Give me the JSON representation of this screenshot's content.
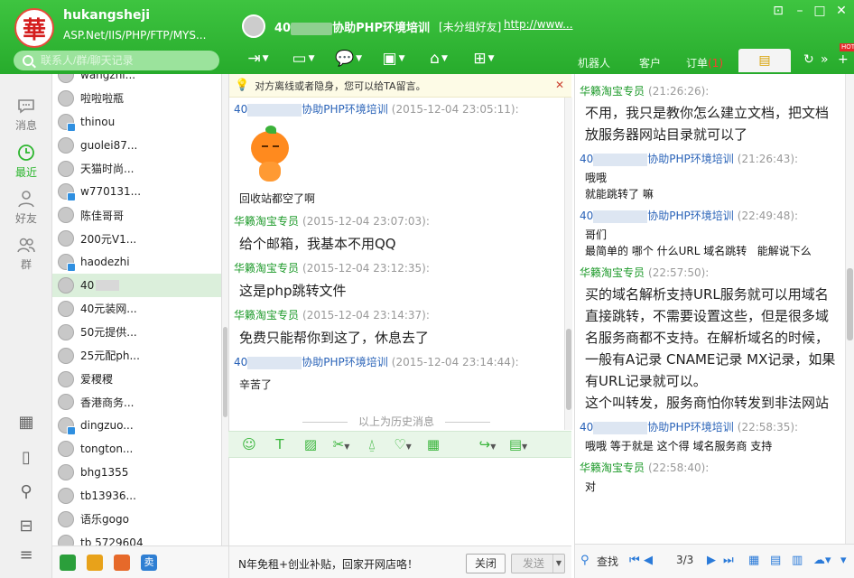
{
  "profile": {
    "avatar_char": "華",
    "name": "hukangsheji",
    "signature": "ASP.Net/IIS/PHP/FTP/MYS..."
  },
  "search": {
    "placeholder": "联系人/群/聊天记录"
  },
  "chat_header": {
    "title_prefix": "40",
    "title_suffix": "协助PHP环境培训",
    "group": "[未分组好友]",
    "url": "http://www..."
  },
  "window_controls": [
    "pin-icon",
    "minimize-icon",
    "maximize-icon",
    "close-icon"
  ],
  "toolbar_icons": [
    "transfer-icon",
    "video-icon",
    "message-icon",
    "screen-icon",
    "remote-icon",
    "schedule-icon"
  ],
  "right_tabs": {
    "robot": "机器人",
    "customer": "客户",
    "order": "订单",
    "order_count": "(1)"
  },
  "left_nav": {
    "messages": "消息",
    "recent": "最近",
    "friends": "好友",
    "groups": "群"
  },
  "contacts": [
    {
      "name": "wangzhi...",
      "badge": false
    },
    {
      "name": "啦啦啦瓶",
      "badge": false
    },
    {
      "name": "thinou",
      "badge": true
    },
    {
      "name": "guolei87...",
      "badge": false
    },
    {
      "name": "天猫时尚...",
      "badge": false
    },
    {
      "name": "w770131...",
      "badge": true
    },
    {
      "name": "陈佳哥哥",
      "badge": false
    },
    {
      "name": "200元V1...",
      "badge": false
    },
    {
      "name": "haodezhi",
      "badge": true
    },
    {
      "name": "40",
      "badge": false,
      "selected": true
    },
    {
      "name": "40元装网...",
      "badge": false
    },
    {
      "name": "50元提供...",
      "badge": false
    },
    {
      "name": "25元配ph...",
      "badge": false
    },
    {
      "name": "爱稷稷",
      "badge": false
    },
    {
      "name": "香港商务...",
      "badge": false
    },
    {
      "name": "dingzuo...",
      "badge": true
    },
    {
      "name": "tongton...",
      "badge": false
    },
    {
      "name": "bhg1355",
      "badge": false
    },
    {
      "name": "tb13936...",
      "badge": false
    },
    {
      "name": "语乐gogo",
      "badge": false
    },
    {
      "name": "tb 5729604",
      "badge": false
    }
  ],
  "notice": "对方离线或者隐身，您可以给TA留言。",
  "chat_messages": [
    {
      "side": "them",
      "sender": "40",
      "sender_suffix": "协助PHP环境培训",
      "time": "(2015-12-04 23:05:11):",
      "text": "回收站都空了啊",
      "sticker": true,
      "size": "small"
    },
    {
      "side": "us",
      "sender": "华籁淘宝专员",
      "sender_suffix": "",
      "time": "(2015-12-04 23:07:03):",
      "text": "给个邮箱，我基本不用QQ",
      "sticker": false,
      "size": "big"
    },
    {
      "side": "us",
      "sender": "华籁淘宝专员",
      "sender_suffix": "",
      "time": "(2015-12-04 23:12:35):",
      "text": "这是php跳转文件",
      "sticker": false,
      "size": "big"
    },
    {
      "side": "us",
      "sender": "华籁淘宝专员",
      "sender_suffix": "",
      "time": "(2015-12-04 23:14:37):",
      "text": "免费只能帮你到这了，休息去了",
      "sticker": false,
      "size": "big"
    },
    {
      "side": "them",
      "sender": "40",
      "sender_suffix": "协助PHP环境培训",
      "time": "(2015-12-04 23:14:44):",
      "text": "辛苦了",
      "sticker": false,
      "size": "small"
    }
  ],
  "history_divider": "以上为历史消息",
  "edit_tools": [
    "emoji-icon",
    "font-icon",
    "image-icon",
    "scissors-icon",
    "shake-icon",
    "heart-icon",
    "table-icon",
    "reply-icon",
    "doc-icon"
  ],
  "send_bar": {
    "ad": "N年免租+创业补贴，回家开网店咯！",
    "close": "关闭",
    "send": "发送"
  },
  "history": [
    {
      "side": "us",
      "sender": "华籁淘宝专员",
      "sender_suffix": "",
      "time": "(21:26:26):",
      "size": "big",
      "text": "不用，我只是教你怎么建立文档，把文档放服务器网站目录就可以了"
    },
    {
      "side": "them",
      "sender": "40",
      "sender_suffix": "协助PHP环境培训",
      "time": "(21:26:43):",
      "size": "small",
      "text": "哦哦\n就能跳转了 嘛"
    },
    {
      "side": "them",
      "sender": "40",
      "sender_suffix": "协助PHP环境培训",
      "time": "(22:49:48):",
      "size": "small",
      "text": "哥们\n最简单的 哪个 什么URL 域名跳转   能解说下么"
    },
    {
      "side": "us",
      "sender": "华籁淘宝专员",
      "sender_suffix": "",
      "time": "(22:57:50):",
      "size": "big",
      "text": "买的域名解析支持URL服务就可以用域名直接跳转，不需要设置这些，但是很多域名服务商都不支持。在解析域名的时候，一般有A记录 CNAME记录 MX记录，如果有URL记录就可以。\n这个叫转发，服务商怕你转发到非法网站"
    },
    {
      "side": "them",
      "sender": "40",
      "sender_suffix": "协助PHP环境培训",
      "time": "(22:58:35):",
      "size": "small",
      "text": "哦哦 等于就是 这个得 域名服务商 支持"
    },
    {
      "side": "us",
      "sender": "华籁淘宝专员",
      "sender_suffix": "",
      "time": "(22:58:40):",
      "size": "small",
      "text": "对"
    }
  ],
  "history_bar": {
    "find": "查找",
    "page": "3/3"
  }
}
